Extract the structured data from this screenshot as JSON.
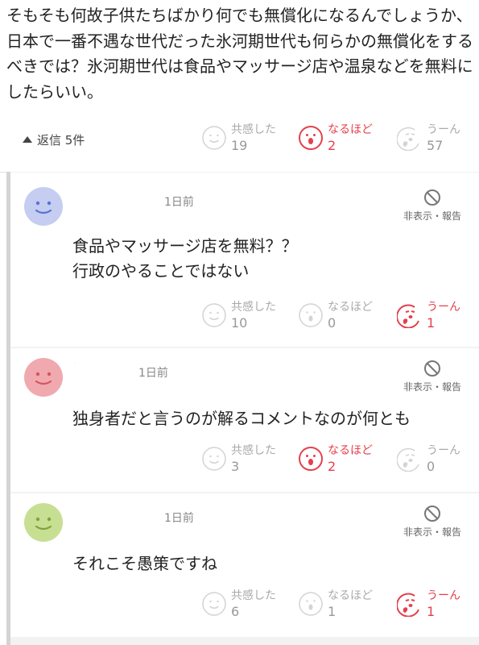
{
  "parent": {
    "text": "そもそも何故子供たちばかり何でも無償化になるんでしょうか、日本で一番不遇な世代だった氷河期世代も何らかの無償化をするべきでは？氷河期世代は食品やマッサージ店や温泉などを無料にしたらいい。",
    "replies_toggle": "返信 5件",
    "reactions": {
      "empathy": {
        "label": "共感した",
        "count": "19",
        "active": false
      },
      "insight": {
        "label": "なるほど",
        "count": "2",
        "active": true
      },
      "hmm": {
        "label": "うーん",
        "count": "57",
        "active": false
      }
    }
  },
  "replies": [
    {
      "avatar_color": "#c5cdf0",
      "author": "",
      "time": "1日前",
      "hide_label": "非表示・報告",
      "lines": [
        "食品やマッサージ店を無料？？",
        "行政のやることではない"
      ],
      "reactions": {
        "empathy": {
          "label": "共感した",
          "count": "10",
          "active": false
        },
        "insight": {
          "label": "なるほど",
          "count": "0",
          "active": false
        },
        "hmm": {
          "label": "うーん",
          "count": "1",
          "active": true
        }
      }
    },
    {
      "avatar_color": "#f0a9ae",
      "author": "·",
      "time": "1日前",
      "hide_label": "非表示・報告",
      "lines": [
        "独身者だと言うのが解るコメントなのが何とも"
      ],
      "reactions": {
        "empathy": {
          "label": "共感した",
          "count": "3",
          "active": false
        },
        "insight": {
          "label": "なるほど",
          "count": "2",
          "active": true
        },
        "hmm": {
          "label": "うーん",
          "count": "0",
          "active": false
        }
      }
    },
    {
      "avatar_color": "#c7df93",
      "author": "",
      "time": "1日前",
      "hide_label": "非表示・報告",
      "lines": [
        "それこそ愚策ですね"
      ],
      "reactions": {
        "empathy": {
          "label": "共感した",
          "count": "6",
          "active": false
        },
        "insight": {
          "label": "なるほど",
          "count": "1",
          "active": false
        },
        "hmm": {
          "label": "うーん",
          "count": "1",
          "active": true
        }
      }
    }
  ],
  "colors": {
    "active": "#e5404c",
    "inactive": "#cccccc",
    "thread_bg": "#f2f2f2"
  },
  "icons": {
    "empathy": "smile-face-icon",
    "insight": "surprised-face-icon",
    "hmm": "troubled-face-icon",
    "hide": "ban-icon"
  }
}
